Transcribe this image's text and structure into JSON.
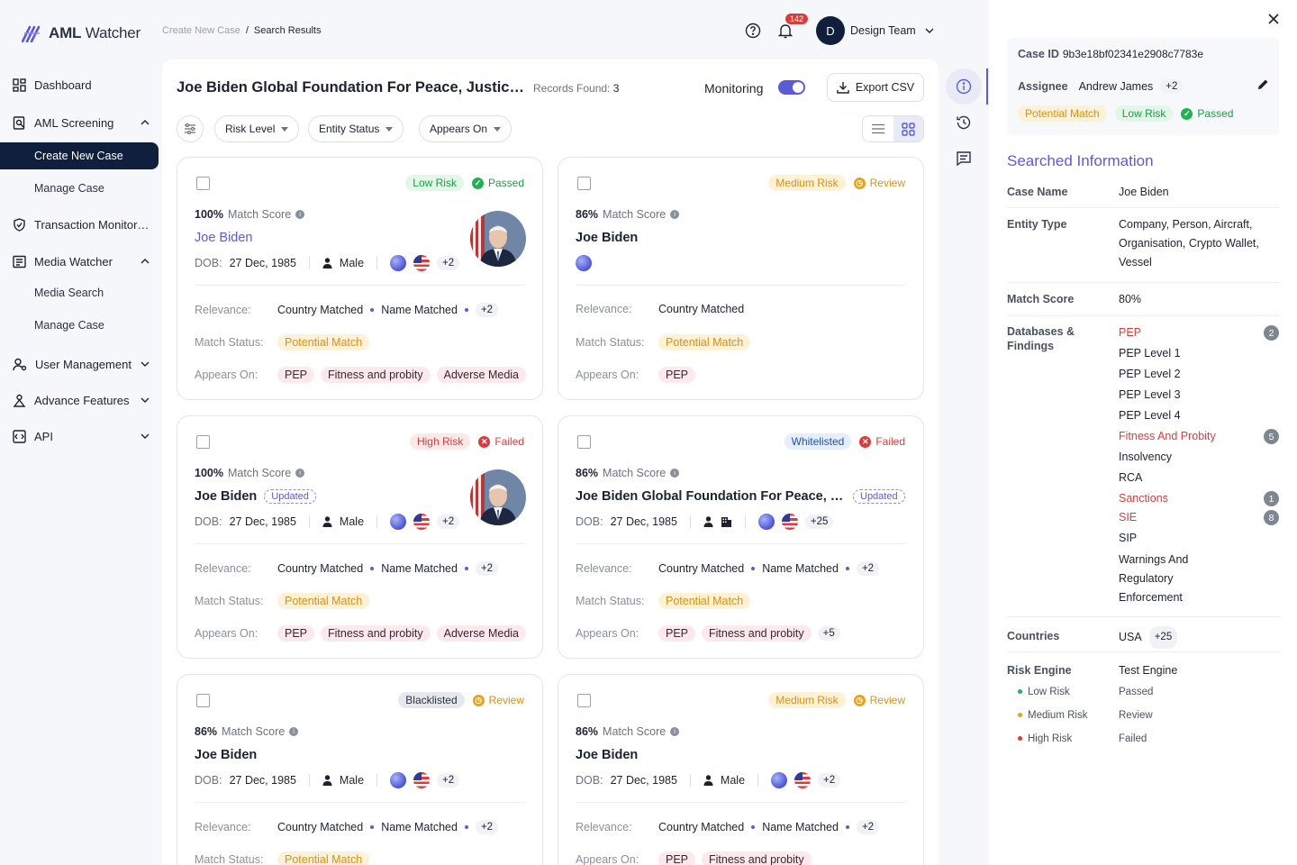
{
  "app": {
    "brand_bold": "AML",
    "brand_rest": " Watcher"
  },
  "sidebar": {
    "dashboard": "Dashboard",
    "aml_screening": "AML Screening",
    "create_new_case": "Create New Case",
    "manage_case": "Manage Case",
    "transaction_monitoring": "Transaction Monitoring",
    "media_watcher": "Media Watcher",
    "media_search": "Media Search",
    "media_manage_case": "Manage Case",
    "user_management": "User Management",
    "advance_features": "Advance Features",
    "api": "API"
  },
  "header": {
    "breadcrumb_parent": "Create New Case",
    "breadcrumb_sep": "/",
    "breadcrumb_current": "Search Results",
    "notifications": "142",
    "avatar_initial": "D",
    "user_name": "Design Team"
  },
  "main": {
    "case_title": "Joe Biden Global Foundation For Peace, Justice And Progress",
    "records_label": "Records Found:",
    "records_count": "3",
    "monitoring_label": "Monitoring",
    "monitoring_on": true,
    "export_label": "Export CSV",
    "filters": {
      "risk_level": "Risk Level",
      "entity_status": "Entity Status",
      "appears_on": "Appears On"
    },
    "view_mode": "grid"
  },
  "labels": {
    "match_score": "Match Score",
    "dob": "DOB:",
    "relevance": "Relevance:",
    "match_status": "Match Status:",
    "appears_on": "Appears On:",
    "updated": "Updated"
  },
  "cards": [
    {
      "risk": "Low Risk",
      "status": "Passed",
      "score": "100%",
      "name": "Joe Biden",
      "dob": "27 Dec, 1985",
      "gender": "Male",
      "countries_more": "+2",
      "relevance": [
        "Country Matched",
        "Name Matched"
      ],
      "relevance_more": "+2",
      "match_status": "Potential Match",
      "appears_on": [
        "PEP",
        "Fitness and probity",
        "Adverse Media"
      ]
    },
    {
      "risk": "Medium Risk",
      "status": "Review",
      "score": "86%",
      "name": "Joe Biden",
      "relevance": [
        "Country Matched"
      ],
      "match_status": "Potential Match",
      "appears_on": [
        "PEP"
      ]
    },
    {
      "risk": "High Risk",
      "status": "Failed",
      "score": "100%",
      "name": "Joe Biden",
      "dob": "27 Dec, 1985",
      "gender": "Male",
      "countries_more": "+2",
      "relevance": [
        "Country Matched",
        "Name Matched"
      ],
      "relevance_more": "+2",
      "match_status": "Potential Match",
      "appears_on": [
        "PEP",
        "Fitness and probity",
        "Adverse Media"
      ]
    },
    {
      "risk": "Whitelisted",
      "status": "Failed",
      "score": "86%",
      "name": "Joe Biden Global Foundation For Peace, Justice And Progress",
      "dob": "27 Dec, 1985",
      "countries_more": "+25",
      "relevance": [
        "Country Matched",
        "Name Matched"
      ],
      "relevance_more": "+2",
      "match_status": "Potential Match",
      "appears_on": [
        "PEP",
        "Fitness and probity"
      ],
      "appears_more": "+5"
    },
    {
      "risk": "Blacklisted",
      "status": "Review",
      "score": "86%",
      "name": "Joe Biden",
      "dob": "27 Dec, 1985",
      "gender": "Male",
      "countries_more": "+2",
      "relevance": [
        "Country Matched",
        "Name Matched"
      ],
      "relevance_more": "+2",
      "match_status": "Potential Match"
    },
    {
      "risk": "Medium Risk",
      "status": "Review",
      "score": "86%",
      "name": "Joe Biden",
      "dob": "27 Dec, 1985",
      "gender": "Male",
      "countries_more": "+2",
      "relevance": [
        "Country Matched",
        "Name Matched"
      ],
      "relevance_more": "+2",
      "appears_on": [
        "PEP",
        "Fitness and probity"
      ]
    }
  ],
  "details": {
    "case_id_label": "Case ID",
    "case_id": "9b3e18bf02341e2908c7783e",
    "assignee_label": "Assignee",
    "assignee": "Andrew James",
    "assignee_more": "+2",
    "summary_match": "Potential Match",
    "summary_risk": "Low Risk",
    "summary_status": "Passed",
    "section_title": "Searched Information",
    "case_name_label": "Case Name",
    "case_name": "Joe Biden",
    "entity_type_label": "Entity Type",
    "entity_type": "Company, Person, Aircraft, Organisation, Crypto Wallet, Vessel",
    "match_score_label": "Match Score",
    "match_score": "80%",
    "databases_label": "Databases & Findings",
    "databases": [
      {
        "name": "PEP",
        "hit": true,
        "count": "2"
      },
      {
        "name": "PEP Level 1"
      },
      {
        "name": "PEP Level 2"
      },
      {
        "name": "PEP Level 3"
      },
      {
        "name": "PEP Level 4"
      },
      {
        "name": "Fitness And Probity",
        "hit": true,
        "count": "5"
      },
      {
        "name": "Insolvency"
      },
      {
        "name": "RCA"
      },
      {
        "name": "Sanctions",
        "hit": true,
        "count": "1"
      },
      {
        "name": "SIE",
        "hit": true,
        "count": "8"
      },
      {
        "name": "SIP"
      },
      {
        "name": "Warnings And Regulatory Enforcement"
      }
    ],
    "countries_label": "Countries",
    "countries": "USA",
    "countries_more": "+25",
    "risk_engine_label": "Risk Engine",
    "risk_engine": "Test Engine",
    "engine_rows": [
      {
        "risk": "Low Risk",
        "result": "Passed",
        "color": "#22b253"
      },
      {
        "risk": "Medium Risk",
        "result": "Review",
        "color": "#e9a21a"
      },
      {
        "risk": "High Risk",
        "result": "Failed",
        "color": "#d63e3e"
      }
    ]
  },
  "colors": {
    "accent": "#5b5bd6",
    "nav_active": "#0f1f3d",
    "danger": "#d63e3e",
    "success": "#22b253",
    "warning": "#e9a21a"
  },
  "icons": [
    "logo-icon",
    "dashboard-icon",
    "screening-icon",
    "shield-icon",
    "media-icon",
    "users-icon",
    "features-icon",
    "api-icon",
    "help-icon",
    "bell-icon",
    "chevron-down-icon",
    "download-icon",
    "filter-icon",
    "list-view-icon",
    "grid-view-icon",
    "info-icon",
    "history-icon",
    "comments-icon",
    "close-icon",
    "edit-icon",
    "globe-icon",
    "us-flag-icon",
    "person-icon",
    "building-icon"
  ]
}
